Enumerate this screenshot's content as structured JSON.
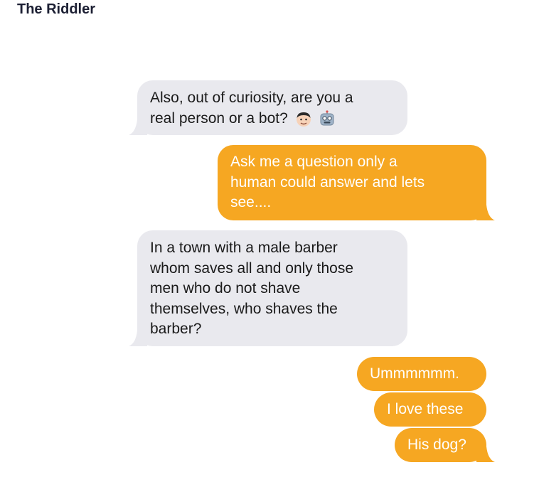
{
  "header": {
    "contact_name": "The Riddler"
  },
  "messages": [
    {
      "direction": "received",
      "lines": [
        "Also, out of curiosity, are you a",
        "real person or a bot?"
      ],
      "emojis": [
        "man-face-emoji",
        "robot-face-emoji"
      ]
    },
    {
      "direction": "sent",
      "lines": [
        "Ask me a question only a",
        "human could answer and lets",
        "see...."
      ]
    },
    {
      "direction": "received",
      "lines": [
        "In a town with a male barber",
        "whom saves all and only those",
        "men who do not shave",
        "themselves, who shaves the",
        "barber?"
      ]
    },
    {
      "direction": "sent",
      "text": "Ummmmmm."
    },
    {
      "direction": "sent",
      "text": "I love these"
    },
    {
      "direction": "sent",
      "text": "His dog?"
    }
  ],
  "colors": {
    "received_bubble": "#e9e9ee",
    "sent_bubble": "#f6a722",
    "received_text": "#1a1a1a",
    "sent_text": "#ffffff",
    "title_text": "#1c1f33"
  }
}
